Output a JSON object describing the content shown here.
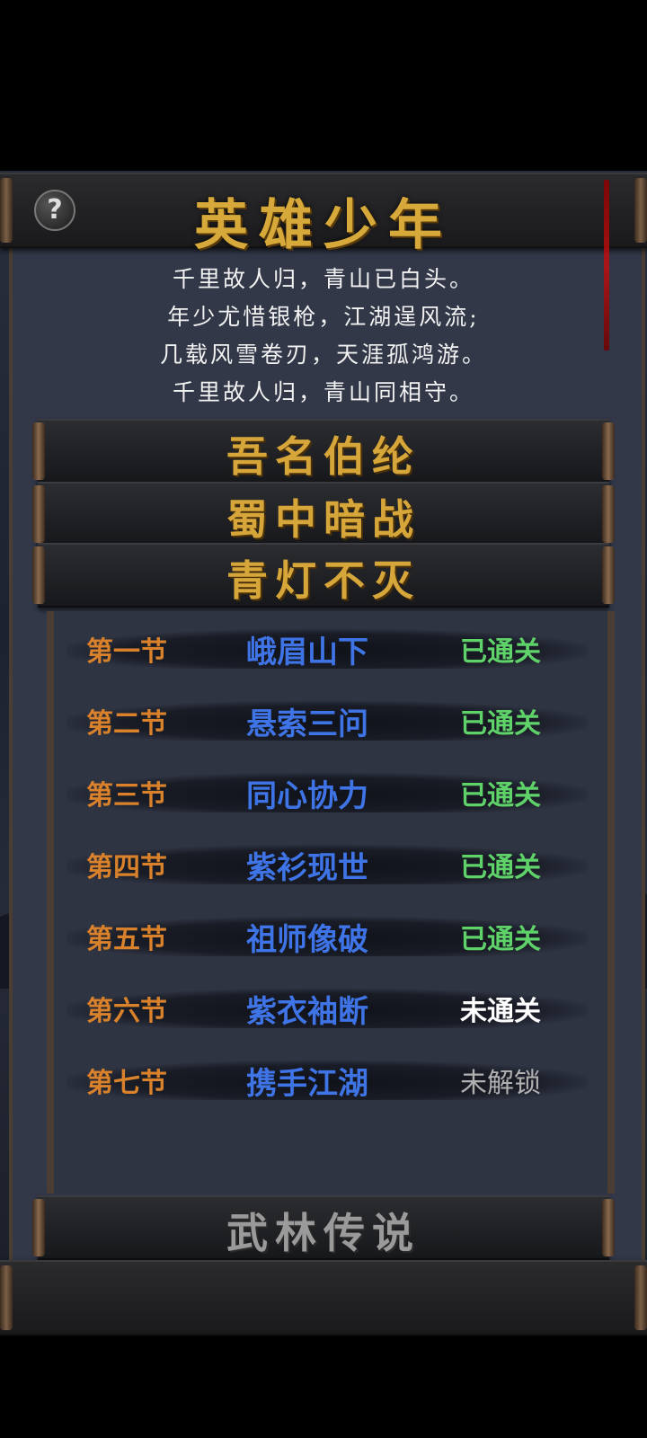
{
  "header": {
    "title": "英雄少年",
    "help_label": "?"
  },
  "poem": [
    "千里故人归，青山已白头。",
    "年少尤惜银枪，江湖逞风流;",
    "几载风雪卷刃，天涯孤鸿游。",
    "千里故人归，青山同相守。"
  ],
  "volumes": [
    {
      "label": "吾名伯纶"
    },
    {
      "label": "蜀中暗战"
    },
    {
      "label": "青灯不灭"
    }
  ],
  "chapters": [
    {
      "section": "第一节",
      "name": "峨眉山下",
      "status": "已通关"
    },
    {
      "section": "第二节",
      "name": "悬索三问",
      "status": "已通关"
    },
    {
      "section": "第三节",
      "name": "同心协力",
      "status": "已通关"
    },
    {
      "section": "第四节",
      "name": "紫衫现世",
      "status": "已通关"
    },
    {
      "section": "第五节",
      "name": "祖师像破",
      "status": "已通关"
    },
    {
      "section": "第六节",
      "name": "紫衣袖断",
      "status": "未通关"
    },
    {
      "section": "第七节",
      "name": "携手江湖",
      "status": "未解锁"
    }
  ],
  "legend_volume": {
    "label": "武林传说"
  },
  "colors": {
    "title_gold": "#d7a93a",
    "section_orange": "#d9822b",
    "chapter_blue": "#3f74e6",
    "cleared_green": "#5fd36a",
    "uncleared_white": "#ffffff",
    "locked_grey": "#b0b0b0"
  }
}
